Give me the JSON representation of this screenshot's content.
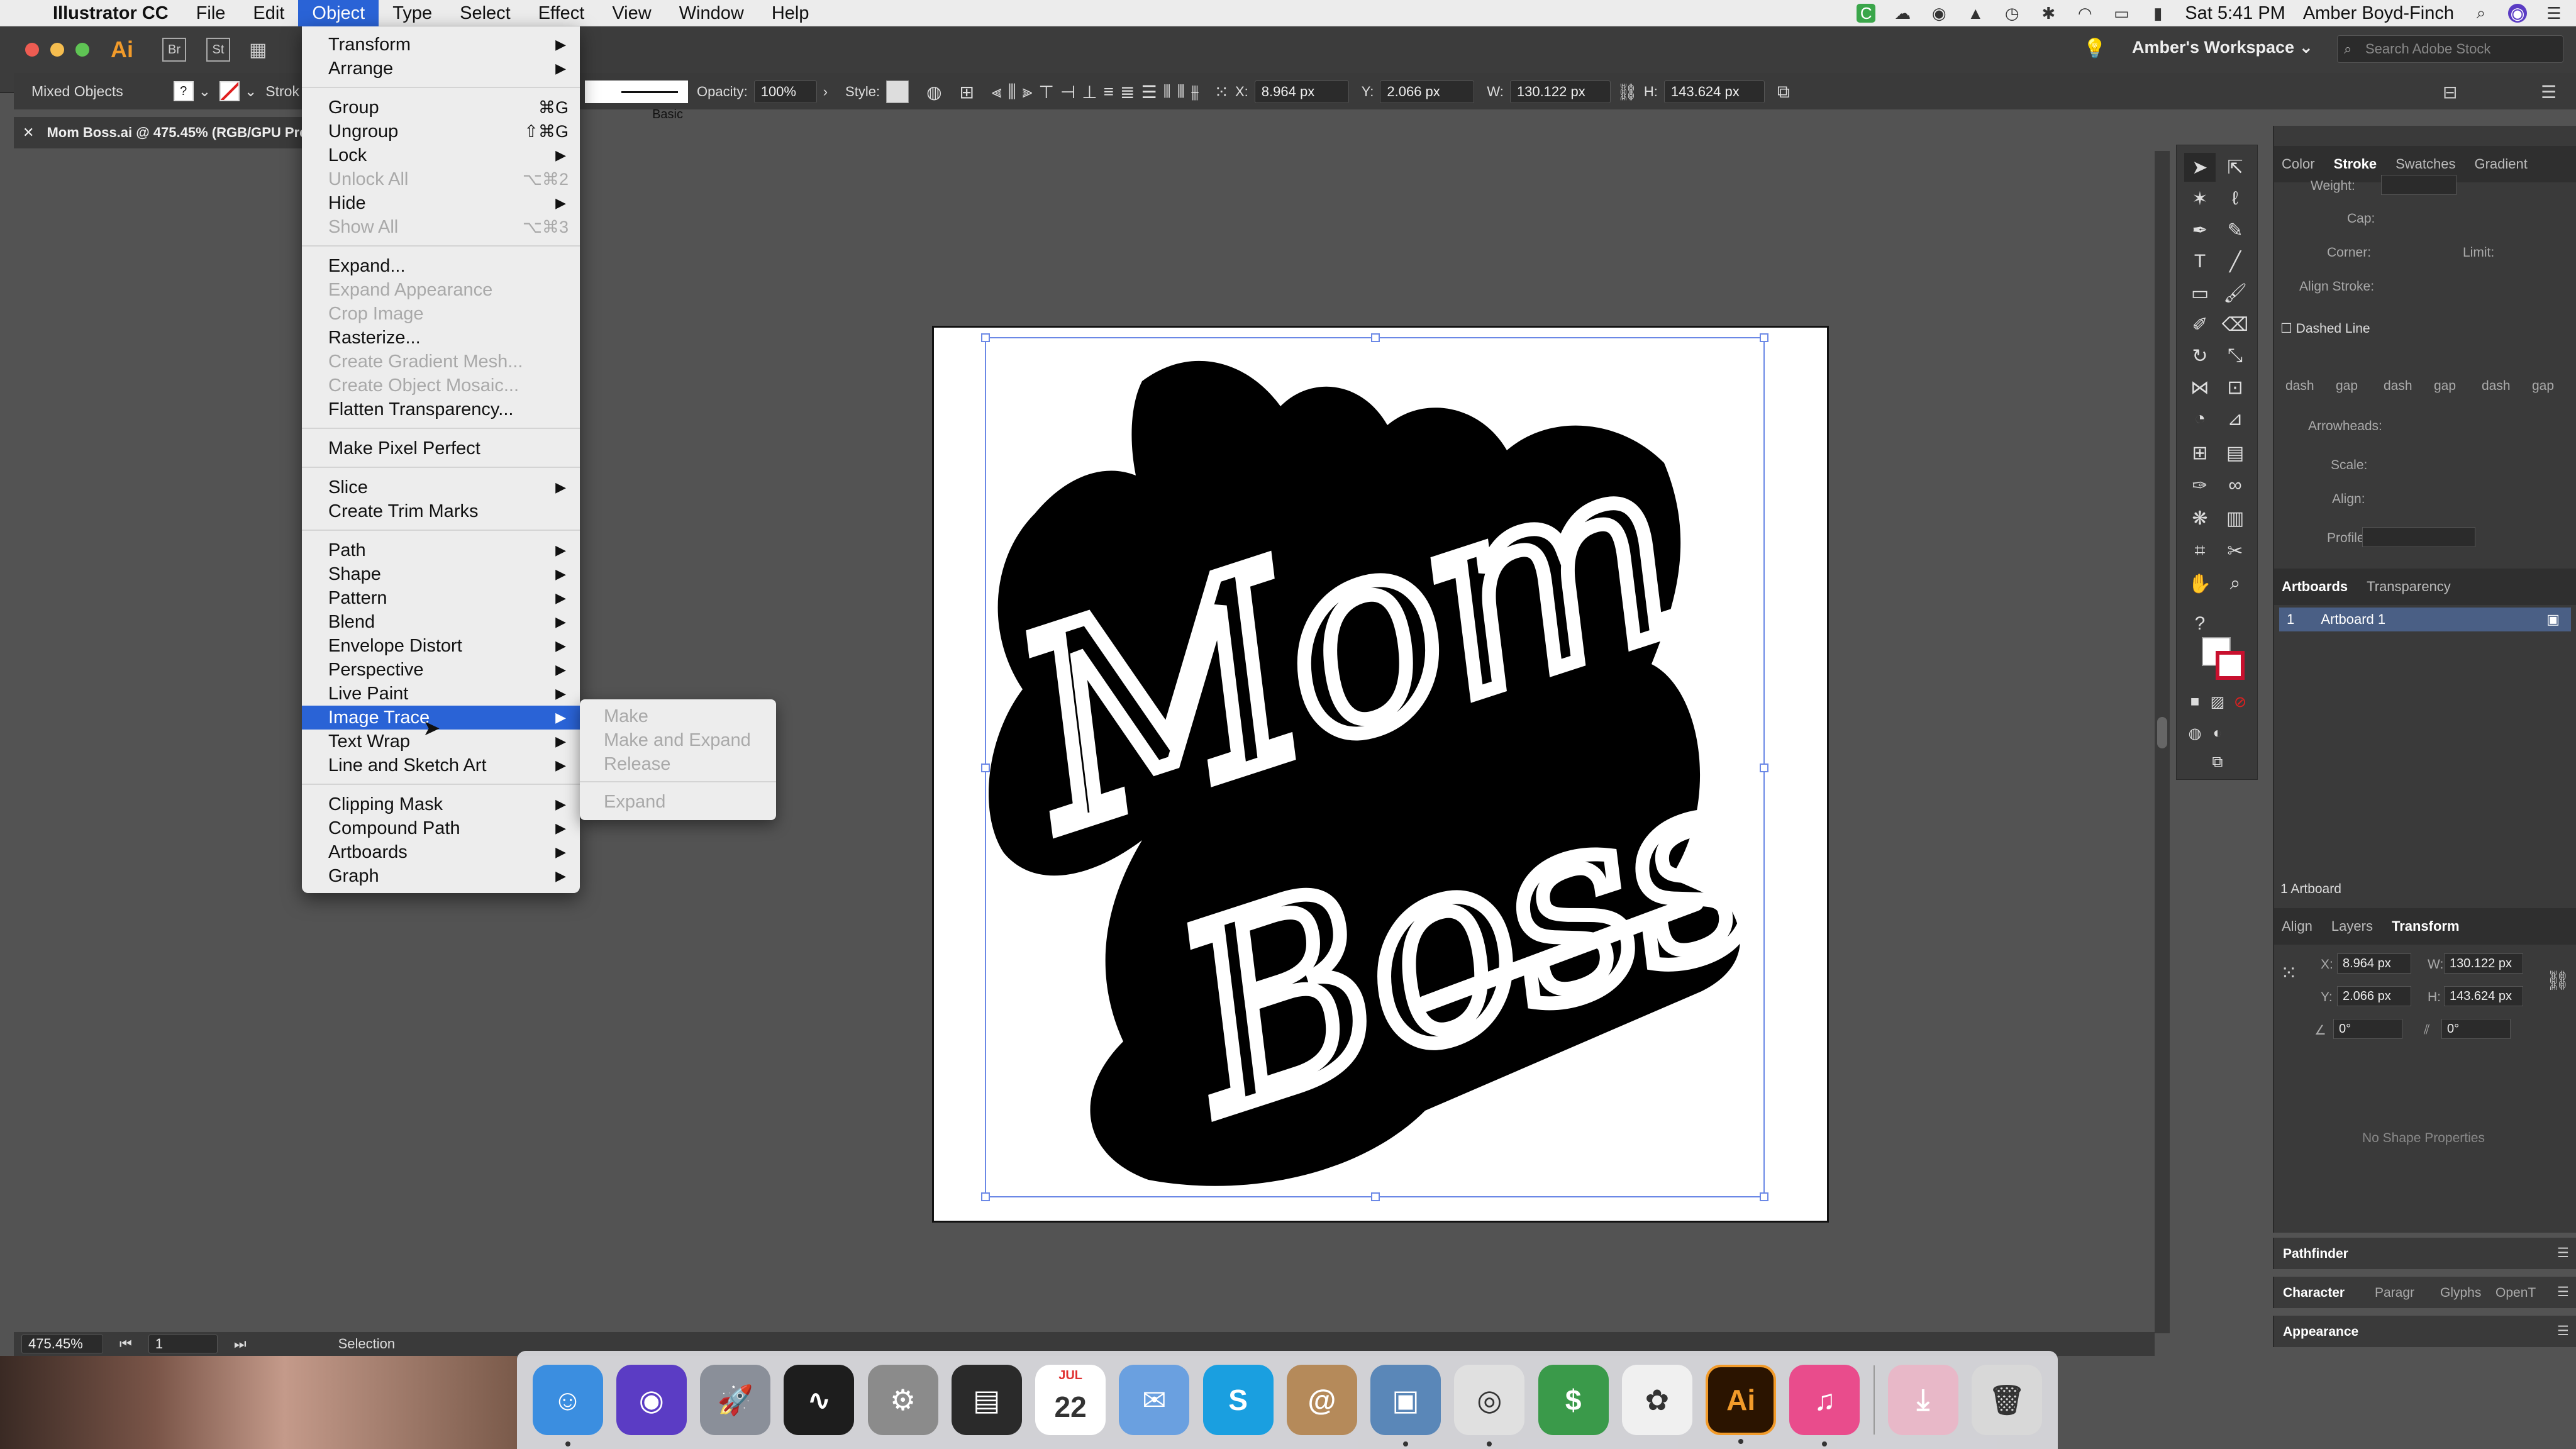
{
  "menubar": {
    "apple": "",
    "app_name": "Illustrator CC",
    "items": [
      "File",
      "Edit",
      "Object",
      "Type",
      "Select",
      "Effect",
      "View",
      "Window",
      "Help"
    ],
    "active": "Object",
    "clock": "Sat 5:41 PM",
    "user": "Amber Boyd-Finch"
  },
  "control_bar": {
    "selection_type": "Mixed Objects",
    "stroke_label": "Strok",
    "brush": "Basic",
    "opacity_label": "Opacity:",
    "opacity_value": "100%",
    "style_label": "Style:",
    "x_label": "X:",
    "x_value": "8.964 px",
    "y_label": "Y:",
    "y_value": "2.066 px",
    "w_label": "W:",
    "w_value": "130.122 px",
    "h_label": "H:",
    "h_value": "143.624 px",
    "workspace": "Amber's Workspace",
    "search_placeholder": "Search Adobe Stock"
  },
  "document_tab": "Mom Boss.ai @ 475.45% (RGB/GPU Previ",
  "object_menu": {
    "items": [
      {
        "label": "Transform",
        "submenu": true
      },
      {
        "label": "Arrange",
        "submenu": true
      },
      {
        "label": "Group",
        "shortcut": "⌘G"
      },
      {
        "label": "Ungroup",
        "shortcut": "⇧⌘G"
      },
      {
        "label": "Lock",
        "submenu": true
      },
      {
        "label": "Unlock All",
        "shortcut": "⌥⌘2",
        "disabled": true
      },
      {
        "label": "Hide",
        "submenu": true
      },
      {
        "label": "Show All",
        "shortcut": "⌥⌘3",
        "disabled": true
      },
      {
        "label": "Expand..."
      },
      {
        "label": "Expand Appearance",
        "disabled": true
      },
      {
        "label": "Crop Image",
        "disabled": true
      },
      {
        "label": "Rasterize..."
      },
      {
        "label": "Create Gradient Mesh...",
        "disabled": true
      },
      {
        "label": "Create Object Mosaic...",
        "disabled": true
      },
      {
        "label": "Flatten Transparency..."
      },
      {
        "label": "Make Pixel Perfect"
      },
      {
        "label": "Slice",
        "submenu": true
      },
      {
        "label": "Create Trim Marks"
      },
      {
        "label": "Path",
        "submenu": true
      },
      {
        "label": "Shape",
        "submenu": true
      },
      {
        "label": "Pattern",
        "submenu": true
      },
      {
        "label": "Blend",
        "submenu": true
      },
      {
        "label": "Envelope Distort",
        "submenu": true
      },
      {
        "label": "Perspective",
        "submenu": true
      },
      {
        "label": "Live Paint",
        "submenu": true
      },
      {
        "label": "Image Trace",
        "submenu": true,
        "highlighted": true
      },
      {
        "label": "Text Wrap",
        "submenu": true
      },
      {
        "label": "Line and Sketch Art",
        "submenu": true
      },
      {
        "label": "Clipping Mask",
        "submenu": true
      },
      {
        "label": "Compound Path",
        "submenu": true
      },
      {
        "label": "Artboards",
        "submenu": true
      },
      {
        "label": "Graph",
        "submenu": true
      }
    ]
  },
  "image_trace_submenu": [
    "Make",
    "Make and Expand",
    "Release",
    "Expand"
  ],
  "stroke_panel": {
    "tabs": [
      "Color",
      "Stroke",
      "Swatches",
      "Gradient"
    ],
    "active_tab": "Stroke",
    "weight": "Weight:",
    "cap": "Cap:",
    "corner": "Corner:",
    "limit": "Limit:",
    "align_stroke": "Align Stroke:",
    "dashed_line": "Dashed Line",
    "dash_labels": [
      "dash",
      "gap",
      "dash",
      "gap",
      "dash",
      "gap"
    ],
    "arrowheads": "Arrowheads:",
    "scale": "Scale:",
    "align": "Align:",
    "profile": "Profile:"
  },
  "artboards_panel": {
    "tabs": [
      "Artboards",
      "Transparency"
    ],
    "rows": [
      {
        "num": "1",
        "name": "Artboard 1"
      }
    ],
    "footer": "1 Artboard"
  },
  "transform_panel": {
    "tabs": [
      "Align",
      "Layers",
      "Transform"
    ],
    "x_label": "X:",
    "x": "8.964 px",
    "y_label": "Y:",
    "y": "2.066 px",
    "w_label": "W:",
    "w": "130.122 px",
    "h_label": "H:",
    "h": "143.624 px",
    "rotate": "0°",
    "shear": "0°",
    "no_shape": "No Shape Properties"
  },
  "collapsed_panels": [
    "Pathfinder",
    "Character",
    "Appearance"
  ],
  "char_tabs": [
    "Character",
    "Paragr",
    "Glyphs",
    "OpenT"
  ],
  "status_bar": {
    "zoom": "475.45%",
    "artboard": "1",
    "tool": "Selection"
  },
  "artwork_text": [
    "Mom",
    "Boss"
  ],
  "dock": [
    {
      "name": "finder",
      "color": "#3b8ee0",
      "glyph": "☺"
    },
    {
      "name": "siri",
      "color": "#5b3cc4",
      "glyph": "◉"
    },
    {
      "name": "launchpad",
      "color": "#8a8f99",
      "glyph": "🚀"
    },
    {
      "name": "activity-monitor",
      "color": "#1d1d1d",
      "glyph": "∿"
    },
    {
      "name": "system-preferences",
      "color": "#8b8b8b",
      "glyph": "⚙"
    },
    {
      "name": "screenshot-app",
      "color": "#2a2a2a",
      "glyph": "▤"
    },
    {
      "name": "calendar",
      "color": "#ffffff",
      "glyph": "22",
      "month": "JUL"
    },
    {
      "name": "mail-bird",
      "color": "#6aa0e0",
      "glyph": "✉"
    },
    {
      "name": "s-app",
      "color": "#1a9fe0",
      "glyph": "S"
    },
    {
      "name": "contacts",
      "color": "#b58a5a",
      "glyph": "@"
    },
    {
      "name": "preview",
      "color": "#5a87b8",
      "glyph": "▣"
    },
    {
      "name": "chrome",
      "color": "#e0e0e0",
      "glyph": "◎"
    },
    {
      "name": "money-app",
      "color": "#3a9a4a",
      "glyph": "$"
    },
    {
      "name": "photos",
      "color": "#f0f0f0",
      "glyph": "✿"
    },
    {
      "name": "illustrator",
      "color": "#2b1400",
      "glyph": "Ai"
    },
    {
      "name": "itunes",
      "color": "#e94c8c",
      "glyph": "♫"
    },
    {
      "name": "downloads-stack",
      "color": "#e8b8c8",
      "glyph": "⤓"
    },
    {
      "name": "trash",
      "color": "#d8d8d8",
      "glyph": "🗑"
    }
  ]
}
